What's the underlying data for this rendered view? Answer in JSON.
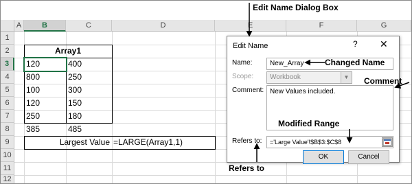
{
  "sheet": {
    "columns": [
      "A",
      "B",
      "C",
      "D",
      "E",
      "F",
      "G"
    ],
    "rows": [
      "1",
      "2",
      "3",
      "4",
      "5",
      "6",
      "7",
      "8",
      "9",
      "10",
      "11",
      "12"
    ],
    "selected_column": "B",
    "selected_row": "3",
    "table_header": "Array1",
    "table_rows": [
      [
        "120",
        "400"
      ],
      [
        "800",
        "250"
      ],
      [
        "100",
        "300"
      ],
      [
        "120",
        "150"
      ],
      [
        "250",
        "180"
      ],
      [
        "385",
        "485"
      ]
    ],
    "largest_label": "Largest Value",
    "largest_formula": "=LARGE(Array1,1)"
  },
  "dialog": {
    "title": "Edit Name",
    "help": "?",
    "close": "✕",
    "name_label": "Name:",
    "name_value": "New_Array",
    "scope_label": "Scope:",
    "scope_value": "Workbook",
    "comment_label": "Comment:",
    "comment_value": "New Values included.",
    "refers_label": "Refers to:",
    "refers_value": "='Large Value'!$B$3:$C$8",
    "ok_label": "OK",
    "cancel_label": "Cancel"
  },
  "annotations": {
    "edit_name_dialog_box": "Edit Name Dialog Box",
    "changed_name": "Changed Name",
    "comment": "Comment",
    "modified_range": "Modified Range",
    "refers_to": "Refers to"
  },
  "colors": {
    "accent": "#217346",
    "default_button_border": "#0078d7"
  }
}
